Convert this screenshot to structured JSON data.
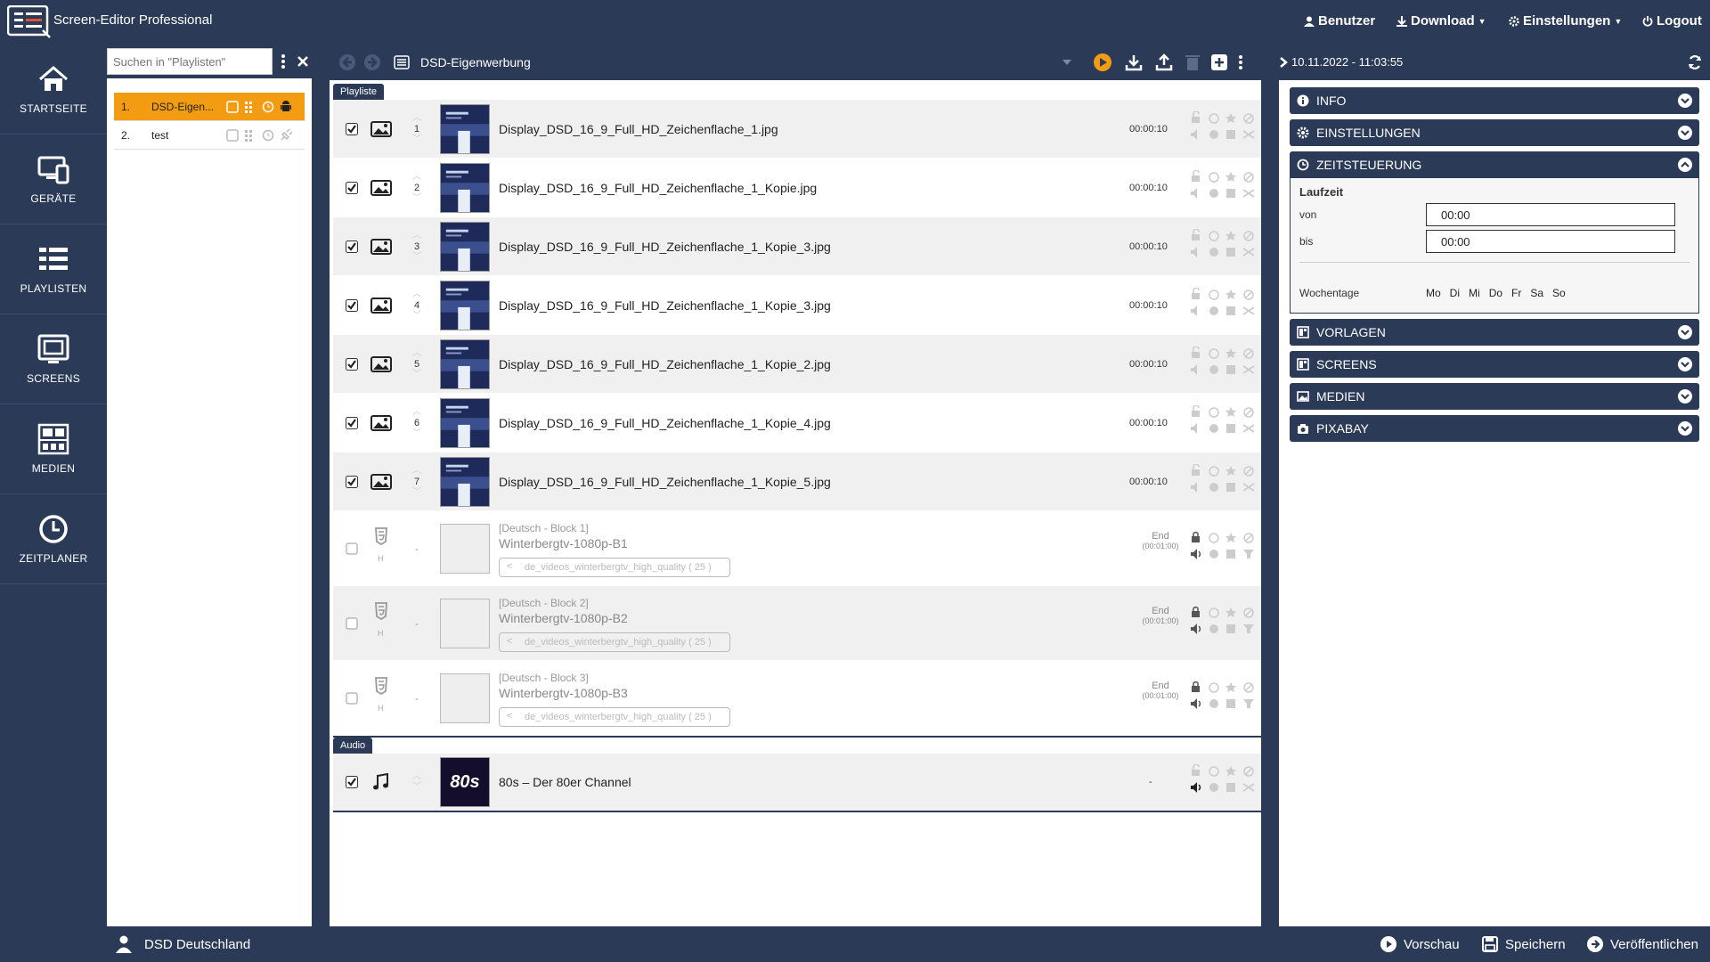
{
  "app": {
    "title": "Screen-Editor Professional"
  },
  "topmenu": {
    "user": "Benutzer",
    "download": "Download",
    "settings": "Einstellungen",
    "logout": "Logout"
  },
  "nav": [
    {
      "label": "STARTSEITE",
      "icon": "home-icon"
    },
    {
      "label": "GERÄTE",
      "icon": "devices-icon"
    },
    {
      "label": "PLAYLISTEN",
      "icon": "playlists-icon"
    },
    {
      "label": "SCREENS",
      "icon": "screens-icon"
    },
    {
      "label": "MEDIEN",
      "icon": "media-icon"
    },
    {
      "label": "ZEITPLANER",
      "icon": "clock-icon"
    }
  ],
  "playlists": {
    "search_placeholder": "Suchen in \"Playlisten\"",
    "items": [
      {
        "num": "1.",
        "name": "DSD-Eigen...",
        "active": true
      },
      {
        "num": "2.",
        "name": "test",
        "active": false
      }
    ]
  },
  "editor": {
    "playlist_title": "DSD-Eigenwerbung",
    "section_playlist": "Playliste",
    "section_audio": "Audio",
    "items": [
      {
        "num": "1",
        "file": "Display_DSD_16_9_Full_HD_Zeichenflache_1.jpg",
        "duration": "00:00:10"
      },
      {
        "num": "2",
        "file": "Display_DSD_16_9_Full_HD_Zeichenflache_1_Kopie.jpg",
        "duration": "00:00:10"
      },
      {
        "num": "3",
        "file": "Display_DSD_16_9_Full_HD_Zeichenflache_1_Kopie_3.jpg",
        "duration": "00:00:10"
      },
      {
        "num": "4",
        "file": "Display_DSD_16_9_Full_HD_Zeichenflache_1_Kopie_3.jpg",
        "duration": "00:00:10"
      },
      {
        "num": "5",
        "file": "Display_DSD_16_9_Full_HD_Zeichenflache_1_Kopie_2.jpg",
        "duration": "00:00:10"
      },
      {
        "num": "6",
        "file": "Display_DSD_16_9_Full_HD_Zeichenflache_1_Kopie_4.jpg",
        "duration": "00:00:10"
      },
      {
        "num": "7",
        "file": "Display_DSD_16_9_Full_HD_Zeichenflache_1_Kopie_5.jpg",
        "duration": "00:00:10"
      }
    ],
    "blocks": [
      {
        "tag": "[Deutsch - Block 1]",
        "name": "Winterbergtv-1080p-B1",
        "source": "de_videos_winterbergtv_high_quality ( 25 )",
        "end": "End",
        "end_time": "(00:01:00)",
        "h": "H",
        "dash": "-"
      },
      {
        "tag": "[Deutsch - Block 2]",
        "name": "Winterbergtv-1080p-B2",
        "source": "de_videos_winterbergtv_high_quality ( 25 )",
        "end": "End",
        "end_time": "(00:01:00)",
        "h": "H",
        "dash": "-"
      },
      {
        "tag": "[Deutsch - Block 3]",
        "name": "Winterbergtv-1080p-B3",
        "source": "de_videos_winterbergtv_high_quality ( 25 )",
        "end": "End",
        "end_time": "(00:01:00)",
        "h": "H",
        "dash": "-"
      }
    ],
    "audio": {
      "name": "80s – Der 80er Channel",
      "duration": "-",
      "thumb_text": "80s"
    }
  },
  "right": {
    "datetime": "10.11.2022 - 11:03:55",
    "sections": {
      "info": "INFO",
      "settings": "EINSTELLUNGEN",
      "time": "ZEITSTEUERUNG",
      "templates": "VORLAGEN",
      "screens": "SCREENS",
      "media": "MEDIEN",
      "pixabay": "PIXABAY"
    },
    "time": {
      "runtime": "Laufzeit",
      "from_label": "von",
      "from": "00:00",
      "to_label": "bis",
      "to": "00:00",
      "weekdays_label": "Wochentage",
      "weekdays": [
        "Mo",
        "Di",
        "Mi",
        "Do",
        "Fr",
        "Sa",
        "So"
      ]
    }
  },
  "bottom": {
    "user": "DSD Deutschland",
    "preview": "Vorschau",
    "save": "Speichern",
    "publish": "Veröffentlichen"
  },
  "colors": {
    "navy": "#2b3a56",
    "accent": "#f39c12"
  }
}
